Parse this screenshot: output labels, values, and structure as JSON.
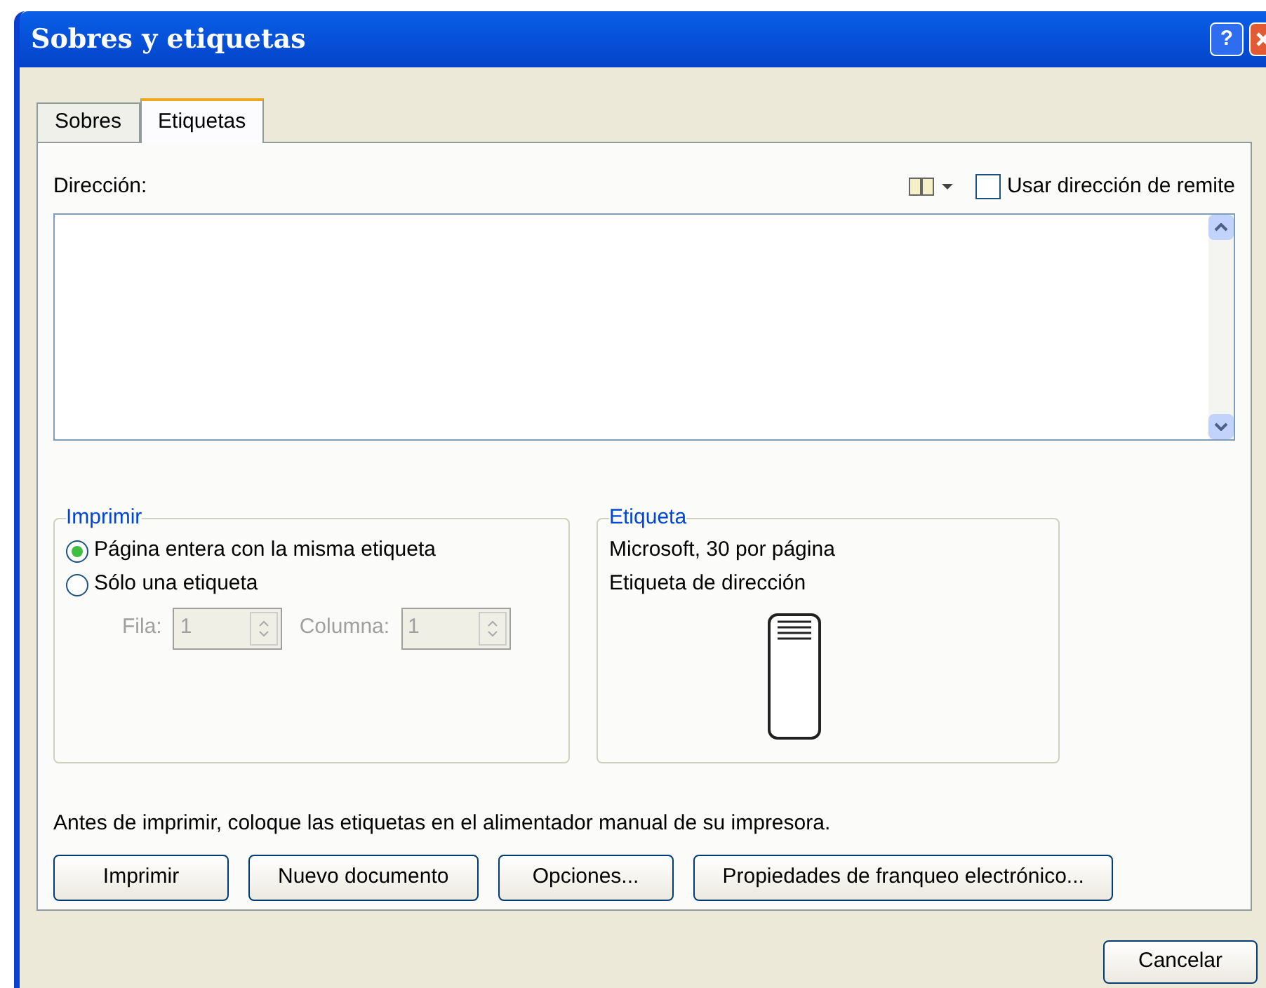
{
  "window": {
    "title": "Sobres y etiquetas",
    "help_button": "?"
  },
  "tabs": [
    {
      "label": "Sobres",
      "selected": false
    },
    {
      "label": "Etiquetas",
      "selected": true
    }
  ],
  "address": {
    "label": "Dirección:",
    "use_return_address": {
      "label": "Usar dirección de remite",
      "checked": false
    }
  },
  "print_group": {
    "title": "Imprimir",
    "options": [
      {
        "label": "Página entera con la misma etiqueta",
        "selected": true
      },
      {
        "label": "Sólo una etiqueta",
        "selected": false
      }
    ],
    "row": {
      "label": "Fila:",
      "value": "1",
      "disabled": true
    },
    "column": {
      "label": "Columna:",
      "value": "1",
      "disabled": true
    }
  },
  "label_group": {
    "title": "Etiqueta",
    "lines": [
      "Microsoft, 30 por página",
      "Etiqueta de dirección"
    ]
  },
  "note": "Antes de imprimir, coloque las etiquetas en el alimentador manual de su impresora.",
  "buttons": [
    "Imprimir",
    "Nuevo documento",
    "Opciones...",
    "Propiedades de franqueo electrónico..."
  ],
  "cancel": "Cancelar"
}
